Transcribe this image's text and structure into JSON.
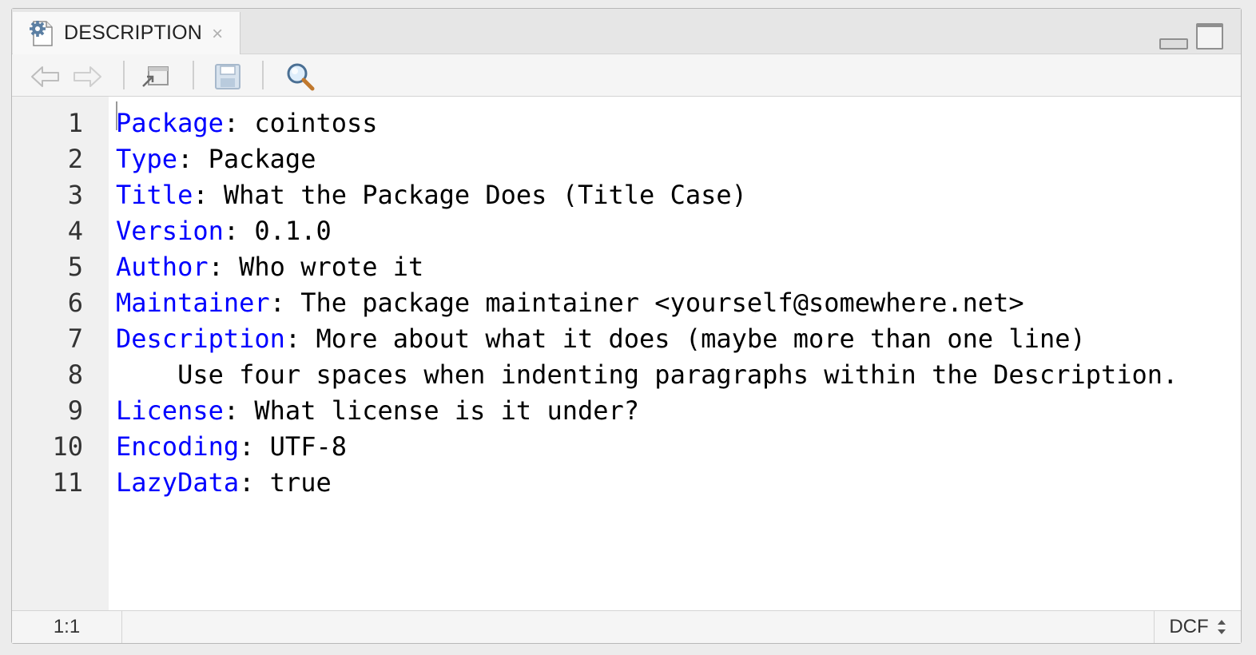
{
  "tab": {
    "icon": "gear-file-icon",
    "label": "DESCRIPTION",
    "close_glyph": "×"
  },
  "toolbar": {
    "icons": [
      "back-arrow-icon",
      "forward-arrow-icon",
      "show-in-window-icon",
      "save-icon",
      "search-icon"
    ]
  },
  "editor": {
    "lines": [
      {
        "number": "1",
        "key": "Package",
        "rest": ": cointoss"
      },
      {
        "number": "2",
        "key": "Type",
        "rest": ": Package"
      },
      {
        "number": "3",
        "key": "Title",
        "rest": ": What the Package Does (Title Case)"
      },
      {
        "number": "4",
        "key": "Version",
        "rest": ": 0.1.0"
      },
      {
        "number": "5",
        "key": "Author",
        "rest": ": Who wrote it"
      },
      {
        "number": "6",
        "key": "Maintainer",
        "rest": ": The package maintainer <yourself@somewhere.net>"
      },
      {
        "number": "7",
        "key": "Description",
        "rest": ": More about what it does (maybe more than one line)"
      },
      {
        "number": "8",
        "key": "",
        "rest": "    Use four spaces when indenting paragraphs within the Description."
      },
      {
        "number": "9",
        "key": "License",
        "rest": ": What license is it under?"
      },
      {
        "number": "10",
        "key": "Encoding",
        "rest": ": UTF-8"
      },
      {
        "number": "11",
        "key": "LazyData",
        "rest": ": true"
      }
    ],
    "colors": {
      "key": "#0000ff",
      "text": "#000000"
    }
  },
  "status": {
    "position": "1:1",
    "file_type": "DCF"
  }
}
